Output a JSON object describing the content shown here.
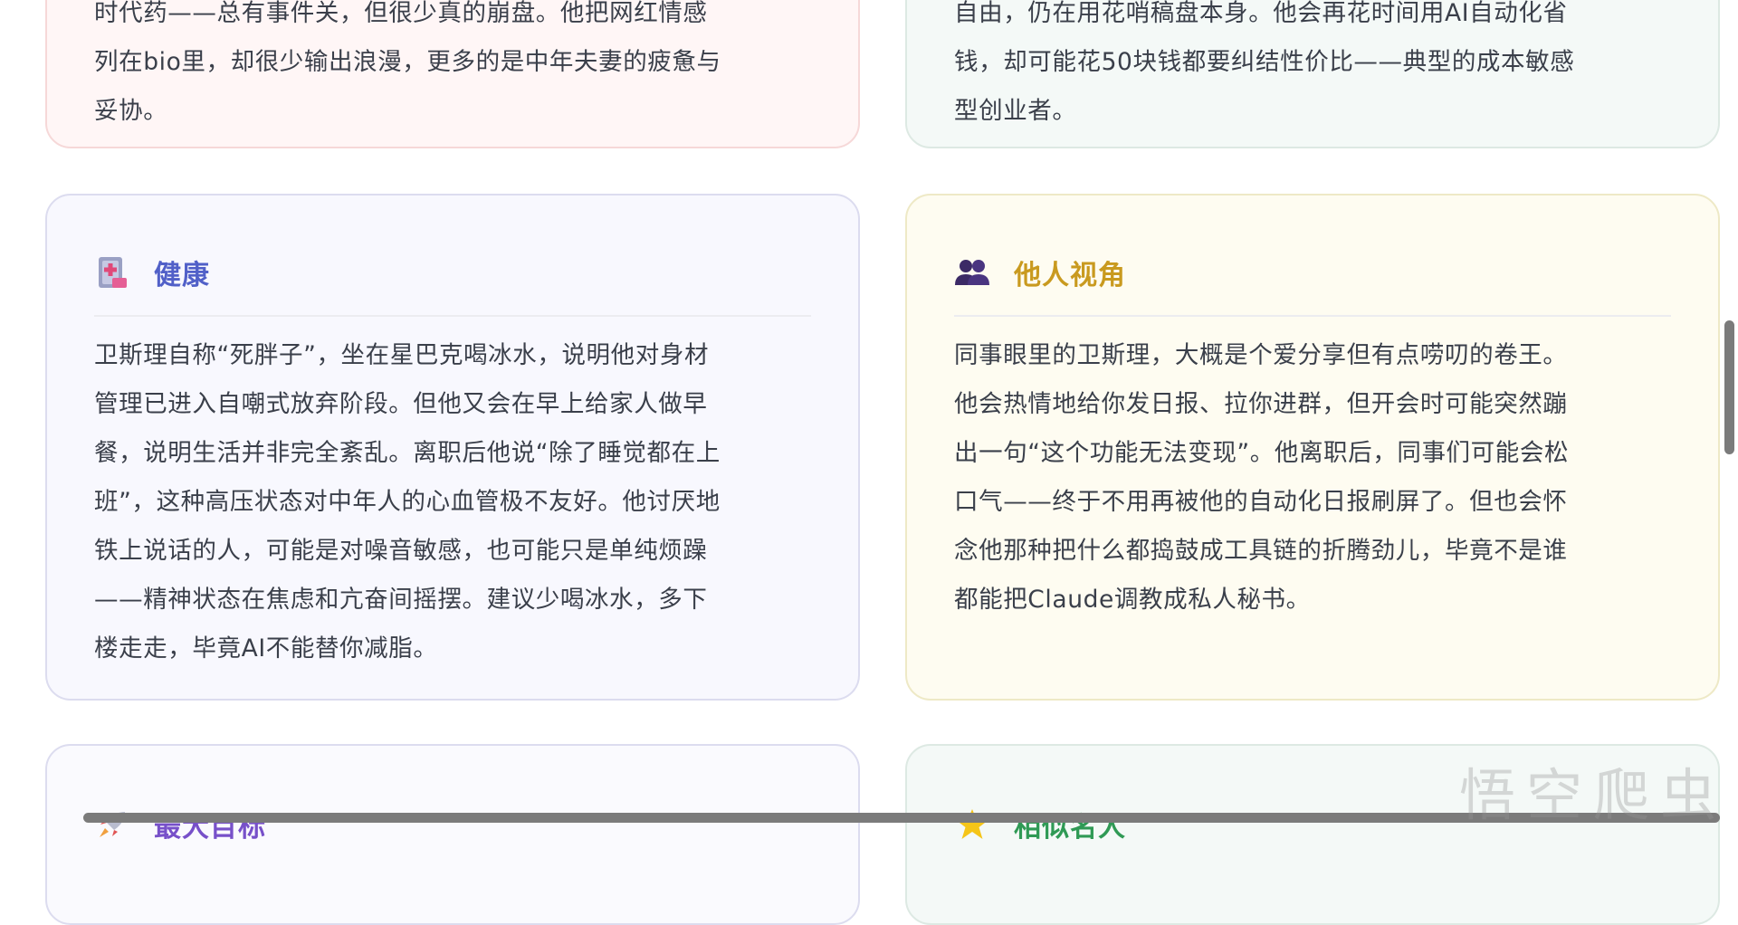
{
  "cards": {
    "top_left": {
      "lines": [
        "时代药——总有事件关，但很少真的崩盘。他把网红情感",
        "列在bio里，却很少输出浪漫，更多的是中年夫妻的疲惫与",
        "妥协。"
      ]
    },
    "top_right": {
      "lines": [
        "自由，仍在用花哨稿盘本身。他会再花时间用AI自动化省",
        "钱，却可能花50块钱都要纠结性价比——典型的成本敏感",
        "型创业者。"
      ]
    },
    "health": {
      "title": "健康",
      "icon": "hospital-icon",
      "lines": [
        "卫斯理自称“死胖子”，坐在星巴克喝冰水，说明他对身材",
        "管理已进入自嘲式放弃阶段。但他又会在早上给家人做早",
        "餐，说明生活并非完全紊乱。离职后他说“除了睡觉都在上",
        "班”，这种高压状态对中年人的心血管极不友好。他讨厌地",
        "铁上说话的人，可能是对噪音敏感，也可能只是单纯烦躁",
        "——精神状态在焦虑和亢奋间摇摆。建议少喝冰水，多下",
        "楼走走，毕竟AI不能替你减脂。"
      ]
    },
    "others_view": {
      "title": "他人视角",
      "icon": "people-icon",
      "lines": [
        "同事眼里的卫斯理，大概是个爱分享但有点唠叨的卷王。",
        "他会热情地给你发日报、拉你进群，但开会时可能突然蹦",
        "出一句“这个功能无法变现”。他离职后，同事们可能会松",
        "口气——终于不用再被他的自动化日报刷屏了。但也会怀",
        "念他那种把什么都捣鼓成工具链的折腾劲儿，毕竟不是谁",
        "都能把Claude调教成私人秘书。"
      ]
    },
    "bottom_left": {
      "title": "最大目标",
      "icon": "rocket-icon"
    },
    "bottom_right": {
      "title": "相似名人",
      "icon": "star-icon"
    }
  },
  "watermark": "悟空爬虫"
}
